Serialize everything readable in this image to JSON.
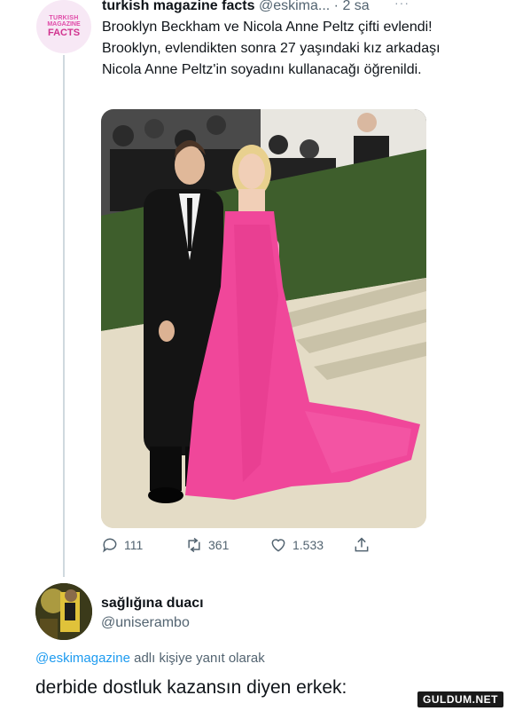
{
  "tweet": {
    "avatar_lines": [
      "TURKISH",
      "MAGAZINE",
      "FACTS"
    ],
    "name": "turkish magazine facts",
    "handle": "@eskima...",
    "time": "· 2 sa",
    "more": "···",
    "text": "Brooklyn Beckham ve Nicola Anne Peltz çifti evlendi! Brooklyn, evlendikten sonra 27 yaşındaki kız arkadaşı Nicola Anne Peltz'in soyadını kullanacağı öğrenildi.",
    "replies": "111",
    "retweets": "361",
    "likes": "1.533"
  },
  "reply": {
    "name": "sağlığına duacı",
    "handle": "@uniserambo",
    "replying_mention": "@eskimagazine",
    "replying_suffix": " adlı kişiye yanıt olarak",
    "text": "derbide dostluk kazansın diyen erkek:"
  },
  "watermark": "GULDUM.NET",
  "colors": {
    "accent": "#1d9bf0",
    "secondary_text": "#536471",
    "dress_pink": "#f0479a"
  }
}
